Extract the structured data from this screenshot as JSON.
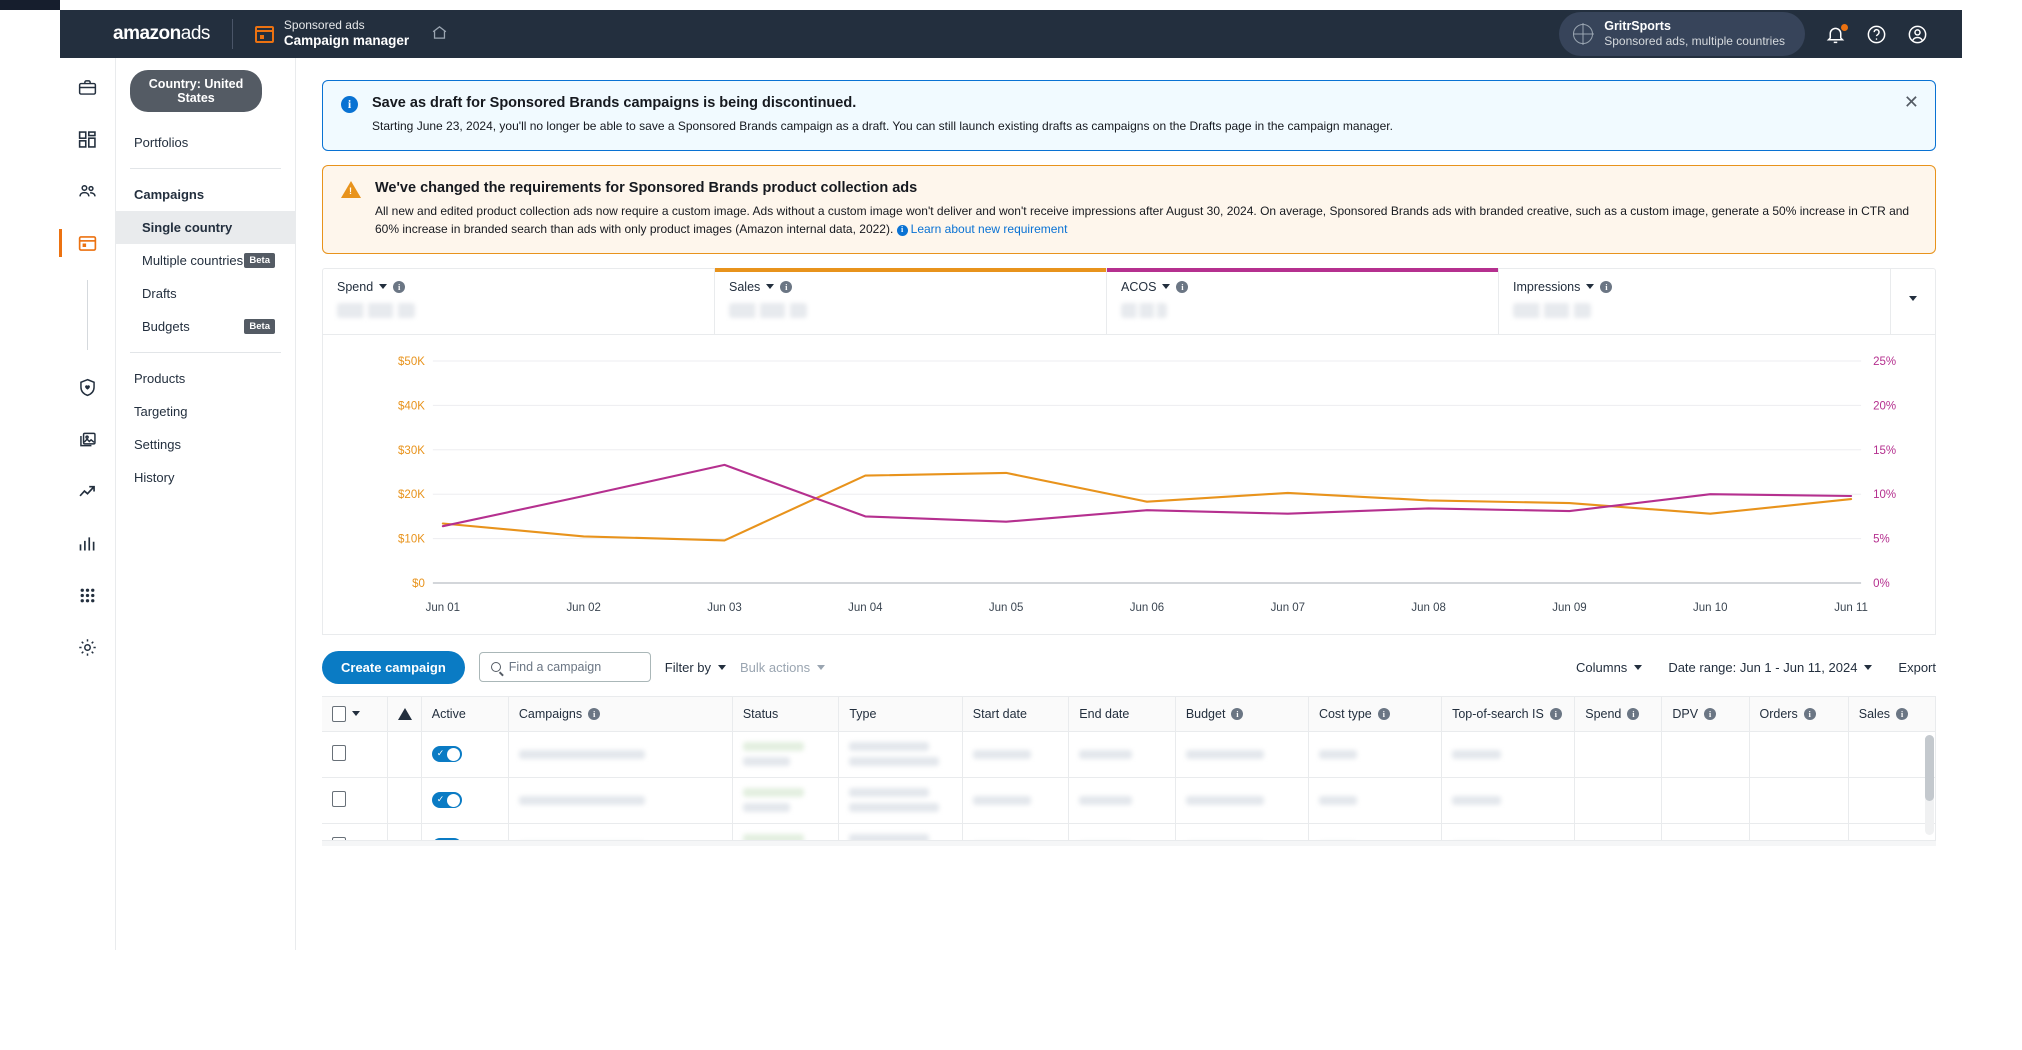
{
  "header": {
    "logo_amazon": "amazon",
    "logo_ads": "ads",
    "app_subtitle": "Sponsored ads",
    "app_title": "Campaign manager",
    "home_icon": "home-icon",
    "account_name": "GritrSports",
    "account_sub": "Sponsored ads, multiple countries",
    "notifications_icon": "bell-icon",
    "help_icon": "help-icon",
    "profile_icon": "user-icon"
  },
  "rail": {
    "items": [
      {
        "icon": "briefcase-icon",
        "active": false
      },
      {
        "icon": "dashboard-grid-icon",
        "active": false
      },
      {
        "icon": "audiences-people-icon",
        "active": false
      },
      {
        "icon": "campaign-window-icon",
        "active": true
      },
      {
        "icon": "shield-heart-icon",
        "active": false
      },
      {
        "icon": "creative-images-icon",
        "active": false
      },
      {
        "icon": "trend-arrow-icon",
        "active": false
      },
      {
        "icon": "bar-chart-icon",
        "active": false
      },
      {
        "icon": "apps-grid-icon",
        "active": false
      },
      {
        "icon": "gear-icon",
        "active": false
      }
    ]
  },
  "subnav": {
    "country_pill": "Country: United States",
    "portfolios": "Portfolios",
    "campaigns_label": "Campaigns",
    "single_country": "Single country",
    "multiple_countries": "Multiple countries",
    "multiple_countries_badge": "Beta",
    "drafts": "Drafts",
    "budgets": "Budgets",
    "budgets_badge": "Beta",
    "products": "Products",
    "targeting": "Targeting",
    "settings": "Settings",
    "history": "History"
  },
  "banners": {
    "info": {
      "icon": "info-circle-icon",
      "title": "Save as draft for Sponsored Brands campaigns is being discontinued.",
      "body": "Starting June 23, 2024, you'll no longer be able to save a Sponsored Brands campaign as a draft. You can still launch existing drafts as campaigns on the Drafts page in the campaign manager.",
      "close_icon": "close-icon"
    },
    "warning": {
      "icon": "warning-triangle-icon",
      "title": "We've changed the requirements for Sponsored Brands product collection ads",
      "body": "All new and edited product collection ads now require a custom image. Ads without a custom image won't deliver and won't receive impressions after August 30, 2024. On average, Sponsored Brands ads with branded creative, such as a custom image, generate a 50% increase in CTR and 60% increase in branded search than ads with only product images (Amazon internal data, 2022).",
      "link_text": "Learn about new requirement"
    }
  },
  "metrics": [
    {
      "label": "Spend",
      "accent": "transparent",
      "value_redacted": true
    },
    {
      "label": "Sales",
      "accent": "#e8931c",
      "value_redacted": true
    },
    {
      "label": "ACOS",
      "accent": "#b5308f",
      "value_redacted": true
    },
    {
      "label": "Impressions",
      "accent": "transparent",
      "value_redacted": true
    }
  ],
  "chart_data": {
    "type": "line",
    "title": "",
    "xlabel": "",
    "x": [
      "Jun 01",
      "Jun 02",
      "Jun 03",
      "Jun 04",
      "Jun 05",
      "Jun 06",
      "Jun 07",
      "Jun 08",
      "Jun 09",
      "Jun 10",
      "Jun 11"
    ],
    "left_axis": {
      "label": "Sales",
      "ticks": [
        "$0",
        "$10K",
        "$20K",
        "$30K",
        "$40K",
        "$50K"
      ],
      "tick_values": [
        0,
        10000,
        20000,
        30000,
        40000,
        50000
      ],
      "ylim": [
        0,
        50000
      ],
      "color": "#e8931c"
    },
    "right_axis": {
      "label": "ACOS",
      "ticks": [
        "0%",
        "5%",
        "10%",
        "15%",
        "20%",
        "25%"
      ],
      "tick_values": [
        0,
        5,
        10,
        15,
        20,
        25
      ],
      "ylim": [
        0,
        25
      ],
      "color": "#b5308f"
    },
    "grid": true,
    "legend": "metric-tabs",
    "series": [
      {
        "name": "Sales",
        "axis": "left",
        "color": "#e8931c",
        "values": [
          13400,
          10500,
          9600,
          24200,
          24800,
          18300,
          20300,
          18600,
          18000,
          15600,
          18900
        ]
      },
      {
        "name": "ACOS",
        "axis": "right",
        "color": "#b5308f",
        "values": [
          6.4,
          9.8,
          13.3,
          7.5,
          6.9,
          8.2,
          7.8,
          8.4,
          8.1,
          10.0,
          9.8
        ]
      }
    ]
  },
  "toolbar": {
    "create_campaign": "Create campaign",
    "search_placeholder": "Find a campaign",
    "search_value": "",
    "search_icon": "search-icon",
    "filter_by": "Filter by",
    "bulk_actions": "Bulk actions",
    "columns": "Columns",
    "date_range": "Date range: Jun 1 - Jun 11, 2024",
    "export": "Export"
  },
  "table": {
    "columns": [
      {
        "label": "",
        "info": false,
        "name": "select-all"
      },
      {
        "label": "",
        "info": false,
        "name": "alert"
      },
      {
        "label": "Active",
        "info": false,
        "name": "active"
      },
      {
        "label": "Campaigns",
        "info": true,
        "name": "campaigns"
      },
      {
        "label": "Status",
        "info": false,
        "name": "status"
      },
      {
        "label": "Type",
        "info": false,
        "name": "type"
      },
      {
        "label": "Start date",
        "info": false,
        "name": "start-date"
      },
      {
        "label": "End date",
        "info": false,
        "name": "end-date"
      },
      {
        "label": "Budget",
        "info": true,
        "name": "budget"
      },
      {
        "label": "Cost type",
        "info": true,
        "name": "cost-type"
      },
      {
        "label": "Top-of-search IS",
        "info": true,
        "name": "top-of-search-is"
      },
      {
        "label": "Spend",
        "info": true,
        "name": "spend"
      },
      {
        "label": "DPV",
        "info": true,
        "name": "dpv"
      },
      {
        "label": "Orders",
        "info": true,
        "name": "orders"
      },
      {
        "label": "Sales",
        "info": true,
        "name": "sales"
      }
    ],
    "rows": [
      {
        "active": true,
        "redacted": true
      },
      {
        "active": true,
        "redacted": true
      },
      {
        "active": true,
        "redacted": true
      }
    ]
  }
}
